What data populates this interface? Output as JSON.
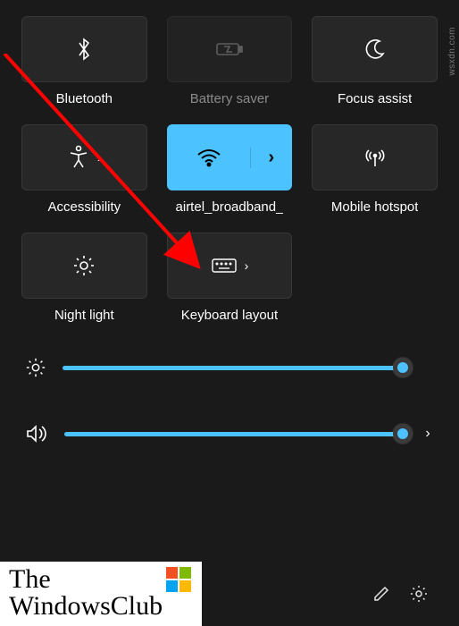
{
  "tiles": [
    {
      "label": "Bluetooth",
      "icon": "bluetooth",
      "state": "normal"
    },
    {
      "label": "Battery saver",
      "icon": "battery",
      "state": "disabled"
    },
    {
      "label": "Focus assist",
      "icon": "moon",
      "state": "normal"
    },
    {
      "label": "Accessibility",
      "icon": "accessibility",
      "state": "normal",
      "chevron": true
    },
    {
      "label": "airtel_broadband_",
      "icon": "wifi",
      "state": "active",
      "split": true
    },
    {
      "label": "Mobile hotspot",
      "icon": "hotspot",
      "state": "normal"
    },
    {
      "label": "Night light",
      "icon": "brightness",
      "state": "normal"
    },
    {
      "label": "Keyboard layout",
      "icon": "keyboard",
      "state": "normal",
      "chevron": true
    }
  ],
  "sliders": {
    "brightness": {
      "value": 100
    },
    "volume": {
      "value": 100,
      "expandable": true
    }
  },
  "watermark": {
    "line1": "The",
    "line2": "WindowsClub"
  },
  "side_credit": "wsxdn.com",
  "colors": {
    "accent": "#4cc2ff",
    "bg": "#1a1a1a"
  }
}
